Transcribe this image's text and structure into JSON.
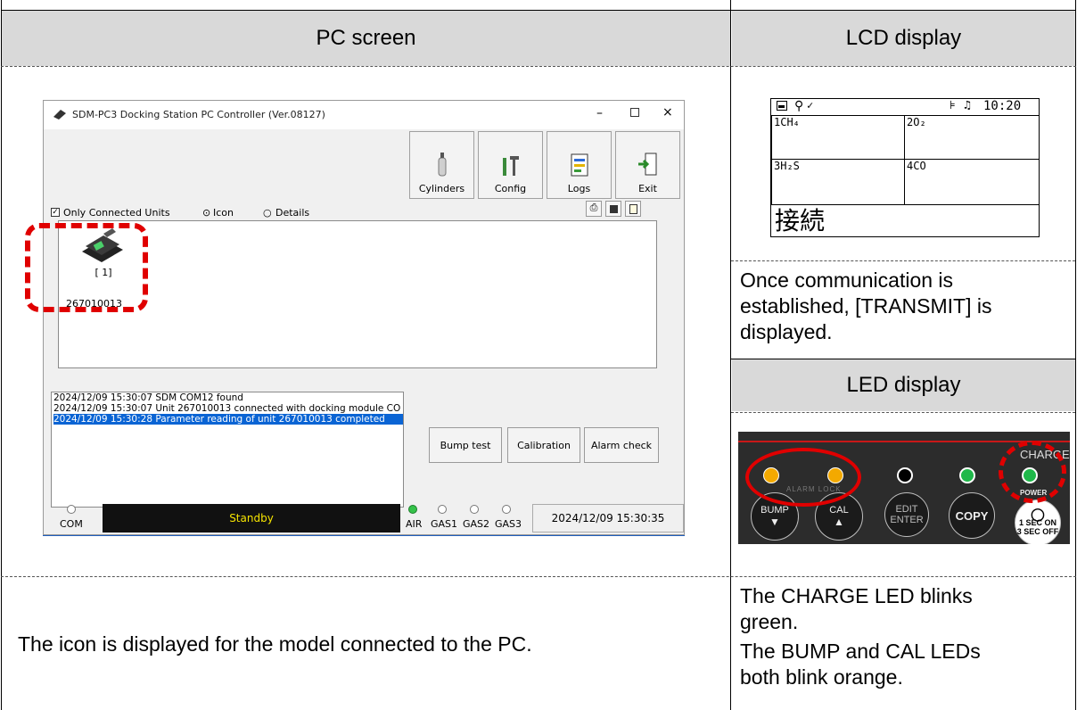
{
  "headers": {
    "pc_screen": "PC screen",
    "lcd_display": "LCD display",
    "led_display": "LED display"
  },
  "pc_window": {
    "title": "SDM-PC3 Docking Station PC Controller (Ver.08127)",
    "toolbar": [
      "Cylinders",
      "Config",
      "Logs",
      "Exit"
    ],
    "only_connected": "Only Connected Units",
    "opt_icon": "Icon",
    "opt_details": "Details",
    "unit_index": "[ 1]",
    "unit_serial": "267010013",
    "log_lines": [
      "2024/12/09 15:30:07 SDM COM12 found",
      "2024/12/09 15:30:07 Unit 267010013 connected with docking module CO",
      "2024/12/09 15:30:28 Parameter reading of unit 267010013 completed"
    ],
    "buttons": [
      "Bump test",
      "Calibration",
      "Alarm check"
    ],
    "status_text": "Standby",
    "status_labels": [
      "COM",
      "AIR",
      "GAS1",
      "GAS2",
      "GAS3"
    ],
    "datetime": "2024/12/09 15:30:35"
  },
  "lcd": {
    "time": "10:20",
    "ch1": "1",
    "gas1": "CH₄",
    "ch2": "2",
    "gas2": "O₂",
    "ch3": "3",
    "gas3": "H₂S",
    "ch4": "4",
    "gas4": "CO",
    "message": "接続"
  },
  "lcd_note": [
    "Once communication is",
    "established, [TRANSMIT] is",
    "displayed."
  ],
  "led_panel": {
    "alarm_label": "ALARM LOCK",
    "bump": "BUMP",
    "cal": "CAL",
    "edit": "EDIT",
    "enter": "ENTER",
    "copy": "COPY",
    "charge": "CHARGE",
    "power": "POWER",
    "sec_on": "1 SEC ON",
    "sec_off": "3 SEC OFF"
  },
  "bottom": {
    "left": "The icon is displayed for the model connected to the PC.",
    "right_1": [
      "The CHARGE LED blinks",
      "green."
    ],
    "right_2": [
      "The BUMP and CAL LEDs",
      "both blink orange."
    ]
  },
  "colors": {
    "header_bg": "#d9d9d9",
    "highlight_red": "#e00000",
    "led_orange": "#f3a900",
    "led_green": "#1fb84a",
    "status_text": "#f6e400",
    "selection": "#0a64d4"
  }
}
